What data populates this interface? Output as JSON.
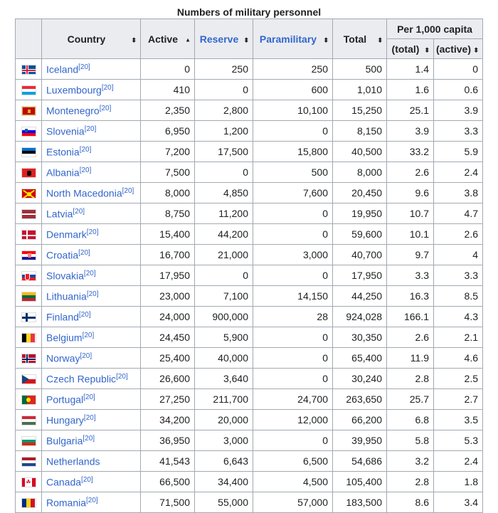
{
  "caption": "Numbers of military personnel",
  "headers": {
    "country": "Country",
    "active": "Active",
    "reserve": "Reserve",
    "paramilitary": "Paramilitary",
    "total": "Total",
    "per_capita": "Per 1,000 capita",
    "per_total": "(total)",
    "per_active": "(active)"
  },
  "sort_arrows": {
    "both": "⬍",
    "up": "▲"
  },
  "rows": [
    {
      "country": "Iceland",
      "ref": "[20]",
      "active": "0",
      "reserve": "250",
      "paramilitary": "250",
      "total": "500",
      "per_total": "1.4",
      "per_active": "0"
    },
    {
      "country": "Luxembourg",
      "ref": "[20]",
      "active": "410",
      "reserve": "0",
      "paramilitary": "600",
      "total": "1,010",
      "per_total": "1.6",
      "per_active": "0.6"
    },
    {
      "country": "Montenegro",
      "ref": "[20]",
      "active": "2,350",
      "reserve": "2,800",
      "paramilitary": "10,100",
      "total": "15,250",
      "per_total": "25.1",
      "per_active": "3.9"
    },
    {
      "country": "Slovenia",
      "ref": "[20]",
      "active": "6,950",
      "reserve": "1,200",
      "paramilitary": "0",
      "total": "8,150",
      "per_total": "3.9",
      "per_active": "3.3"
    },
    {
      "country": "Estonia",
      "ref": "[20]",
      "active": "7,200",
      "reserve": "17,500",
      "paramilitary": "15,800",
      "total": "40,500",
      "per_total": "33.2",
      "per_active": "5.9"
    },
    {
      "country": "Albania",
      "ref": "[20]",
      "active": "7,500",
      "reserve": "0",
      "paramilitary": "500",
      "total": "8,000",
      "per_total": "2.6",
      "per_active": "2.4"
    },
    {
      "country": "North Macedonia",
      "ref": "[20]",
      "active": "8,000",
      "reserve": "4,850",
      "paramilitary": "7,600",
      "total": "20,450",
      "per_total": "9.6",
      "per_active": "3.8"
    },
    {
      "country": "Latvia",
      "ref": "[20]",
      "active": "8,750",
      "reserve": "11,200",
      "paramilitary": "0",
      "total": "19,950",
      "per_total": "10.7",
      "per_active": "4.7"
    },
    {
      "country": "Denmark",
      "ref": "[20]",
      "active": "15,400",
      "reserve": "44,200",
      "paramilitary": "0",
      "total": "59,600",
      "per_total": "10.1",
      "per_active": "2.6"
    },
    {
      "country": "Croatia",
      "ref": "[20]",
      "active": "16,700",
      "reserve": "21,000",
      "paramilitary": "3,000",
      "total": "40,700",
      "per_total": "9.7",
      "per_active": "4"
    },
    {
      "country": "Slovakia",
      "ref": "[20]",
      "active": "17,950",
      "reserve": "0",
      "paramilitary": "0",
      "total": "17,950",
      "per_total": "3.3",
      "per_active": "3.3"
    },
    {
      "country": "Lithuania",
      "ref": "[20]",
      "active": "23,000",
      "reserve": "7,100",
      "paramilitary": "14,150",
      "total": "44,250",
      "per_total": "16.3",
      "per_active": "8.5"
    },
    {
      "country": "Finland",
      "ref": "[20]",
      "active": "24,000",
      "reserve": "900,000",
      "paramilitary": "28",
      "total": "924,028",
      "per_total": "166.1",
      "per_active": "4.3"
    },
    {
      "country": "Belgium",
      "ref": "[20]",
      "active": "24,450",
      "reserve": "5,900",
      "paramilitary": "0",
      "total": "30,350",
      "per_total": "2.6",
      "per_active": "2.1"
    },
    {
      "country": "Norway",
      "ref": "[20]",
      "active": "25,400",
      "reserve": "40,000",
      "paramilitary": "0",
      "total": "65,400",
      "per_total": "11.9",
      "per_active": "4.6"
    },
    {
      "country": "Czech Republic",
      "ref": "[20]",
      "active": "26,600",
      "reserve": "3,640",
      "paramilitary": "0",
      "total": "30,240",
      "per_total": "2.8",
      "per_active": "2.5"
    },
    {
      "country": "Portugal",
      "ref": "[20]",
      "active": "27,250",
      "reserve": "211,700",
      "paramilitary": "24,700",
      "total": "263,650",
      "per_total": "25.7",
      "per_active": "2.7"
    },
    {
      "country": "Hungary",
      "ref": "[20]",
      "active": "34,200",
      "reserve": "20,000",
      "paramilitary": "12,000",
      "total": "66,200",
      "per_total": "6.8",
      "per_active": "3.5"
    },
    {
      "country": "Bulgaria",
      "ref": "[20]",
      "active": "36,950",
      "reserve": "3,000",
      "paramilitary": "0",
      "total": "39,950",
      "per_total": "5.8",
      "per_active": "5.3"
    },
    {
      "country": "Netherlands",
      "ref": "",
      "active": "41,543",
      "reserve": "6,643",
      "paramilitary": "6,500",
      "total": "54,686",
      "per_total": "3.2",
      "per_active": "2.4"
    },
    {
      "country": "Canada",
      "ref": "[20]",
      "active": "66,500",
      "reserve": "34,400",
      "paramilitary": "4,500",
      "total": "105,400",
      "per_total": "2.8",
      "per_active": "1.8"
    },
    {
      "country": "Romania",
      "ref": "[20]",
      "active": "71,500",
      "reserve": "55,000",
      "paramilitary": "57,000",
      "total": "183,500",
      "per_total": "8.6",
      "per_active": "3.4"
    }
  ]
}
